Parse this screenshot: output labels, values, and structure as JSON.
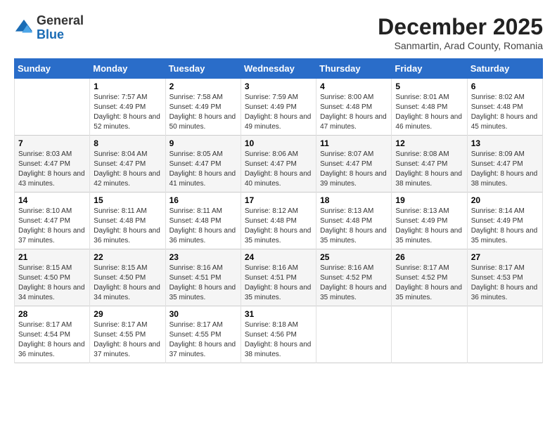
{
  "header": {
    "logo": {
      "general": "General",
      "blue": "Blue"
    },
    "title": "December 2025",
    "subtitle": "Sanmartin, Arad County, Romania"
  },
  "weekdays": [
    "Sunday",
    "Monday",
    "Tuesday",
    "Wednesday",
    "Thursday",
    "Friday",
    "Saturday"
  ],
  "weeks": [
    [
      {
        "day": "",
        "sunrise": "",
        "sunset": "",
        "daylight": ""
      },
      {
        "day": "1",
        "sunrise": "Sunrise: 7:57 AM",
        "sunset": "Sunset: 4:49 PM",
        "daylight": "Daylight: 8 hours and 52 minutes."
      },
      {
        "day": "2",
        "sunrise": "Sunrise: 7:58 AM",
        "sunset": "Sunset: 4:49 PM",
        "daylight": "Daylight: 8 hours and 50 minutes."
      },
      {
        "day": "3",
        "sunrise": "Sunrise: 7:59 AM",
        "sunset": "Sunset: 4:49 PM",
        "daylight": "Daylight: 8 hours and 49 minutes."
      },
      {
        "day": "4",
        "sunrise": "Sunrise: 8:00 AM",
        "sunset": "Sunset: 4:48 PM",
        "daylight": "Daylight: 8 hours and 47 minutes."
      },
      {
        "day": "5",
        "sunrise": "Sunrise: 8:01 AM",
        "sunset": "Sunset: 4:48 PM",
        "daylight": "Daylight: 8 hours and 46 minutes."
      },
      {
        "day": "6",
        "sunrise": "Sunrise: 8:02 AM",
        "sunset": "Sunset: 4:48 PM",
        "daylight": "Daylight: 8 hours and 45 minutes."
      }
    ],
    [
      {
        "day": "7",
        "sunrise": "Sunrise: 8:03 AM",
        "sunset": "Sunset: 4:47 PM",
        "daylight": "Daylight: 8 hours and 43 minutes."
      },
      {
        "day": "8",
        "sunrise": "Sunrise: 8:04 AM",
        "sunset": "Sunset: 4:47 PM",
        "daylight": "Daylight: 8 hours and 42 minutes."
      },
      {
        "day": "9",
        "sunrise": "Sunrise: 8:05 AM",
        "sunset": "Sunset: 4:47 PM",
        "daylight": "Daylight: 8 hours and 41 minutes."
      },
      {
        "day": "10",
        "sunrise": "Sunrise: 8:06 AM",
        "sunset": "Sunset: 4:47 PM",
        "daylight": "Daylight: 8 hours and 40 minutes."
      },
      {
        "day": "11",
        "sunrise": "Sunrise: 8:07 AM",
        "sunset": "Sunset: 4:47 PM",
        "daylight": "Daylight: 8 hours and 39 minutes."
      },
      {
        "day": "12",
        "sunrise": "Sunrise: 8:08 AM",
        "sunset": "Sunset: 4:47 PM",
        "daylight": "Daylight: 8 hours and 38 minutes."
      },
      {
        "day": "13",
        "sunrise": "Sunrise: 8:09 AM",
        "sunset": "Sunset: 4:47 PM",
        "daylight": "Daylight: 8 hours and 38 minutes."
      }
    ],
    [
      {
        "day": "14",
        "sunrise": "Sunrise: 8:10 AM",
        "sunset": "Sunset: 4:47 PM",
        "daylight": "Daylight: 8 hours and 37 minutes."
      },
      {
        "day": "15",
        "sunrise": "Sunrise: 8:11 AM",
        "sunset": "Sunset: 4:48 PM",
        "daylight": "Daylight: 8 hours and 36 minutes."
      },
      {
        "day": "16",
        "sunrise": "Sunrise: 8:11 AM",
        "sunset": "Sunset: 4:48 PM",
        "daylight": "Daylight: 8 hours and 36 minutes."
      },
      {
        "day": "17",
        "sunrise": "Sunrise: 8:12 AM",
        "sunset": "Sunset: 4:48 PM",
        "daylight": "Daylight: 8 hours and 35 minutes."
      },
      {
        "day": "18",
        "sunrise": "Sunrise: 8:13 AM",
        "sunset": "Sunset: 4:48 PM",
        "daylight": "Daylight: 8 hours and 35 minutes."
      },
      {
        "day": "19",
        "sunrise": "Sunrise: 8:13 AM",
        "sunset": "Sunset: 4:49 PM",
        "daylight": "Daylight: 8 hours and 35 minutes."
      },
      {
        "day": "20",
        "sunrise": "Sunrise: 8:14 AM",
        "sunset": "Sunset: 4:49 PM",
        "daylight": "Daylight: 8 hours and 35 minutes."
      }
    ],
    [
      {
        "day": "21",
        "sunrise": "Sunrise: 8:15 AM",
        "sunset": "Sunset: 4:50 PM",
        "daylight": "Daylight: 8 hours and 34 minutes."
      },
      {
        "day": "22",
        "sunrise": "Sunrise: 8:15 AM",
        "sunset": "Sunset: 4:50 PM",
        "daylight": "Daylight: 8 hours and 34 minutes."
      },
      {
        "day": "23",
        "sunrise": "Sunrise: 8:16 AM",
        "sunset": "Sunset: 4:51 PM",
        "daylight": "Daylight: 8 hours and 35 minutes."
      },
      {
        "day": "24",
        "sunrise": "Sunrise: 8:16 AM",
        "sunset": "Sunset: 4:51 PM",
        "daylight": "Daylight: 8 hours and 35 minutes."
      },
      {
        "day": "25",
        "sunrise": "Sunrise: 8:16 AM",
        "sunset": "Sunset: 4:52 PM",
        "daylight": "Daylight: 8 hours and 35 minutes."
      },
      {
        "day": "26",
        "sunrise": "Sunrise: 8:17 AM",
        "sunset": "Sunset: 4:52 PM",
        "daylight": "Daylight: 8 hours and 35 minutes."
      },
      {
        "day": "27",
        "sunrise": "Sunrise: 8:17 AM",
        "sunset": "Sunset: 4:53 PM",
        "daylight": "Daylight: 8 hours and 36 minutes."
      }
    ],
    [
      {
        "day": "28",
        "sunrise": "Sunrise: 8:17 AM",
        "sunset": "Sunset: 4:54 PM",
        "daylight": "Daylight: 8 hours and 36 minutes."
      },
      {
        "day": "29",
        "sunrise": "Sunrise: 8:17 AM",
        "sunset": "Sunset: 4:55 PM",
        "daylight": "Daylight: 8 hours and 37 minutes."
      },
      {
        "day": "30",
        "sunrise": "Sunrise: 8:17 AM",
        "sunset": "Sunset: 4:55 PM",
        "daylight": "Daylight: 8 hours and 37 minutes."
      },
      {
        "day": "31",
        "sunrise": "Sunrise: 8:18 AM",
        "sunset": "Sunset: 4:56 PM",
        "daylight": "Daylight: 8 hours and 38 minutes."
      },
      {
        "day": "",
        "sunrise": "",
        "sunset": "",
        "daylight": ""
      },
      {
        "day": "",
        "sunrise": "",
        "sunset": "",
        "daylight": ""
      },
      {
        "day": "",
        "sunrise": "",
        "sunset": "",
        "daylight": ""
      }
    ]
  ]
}
